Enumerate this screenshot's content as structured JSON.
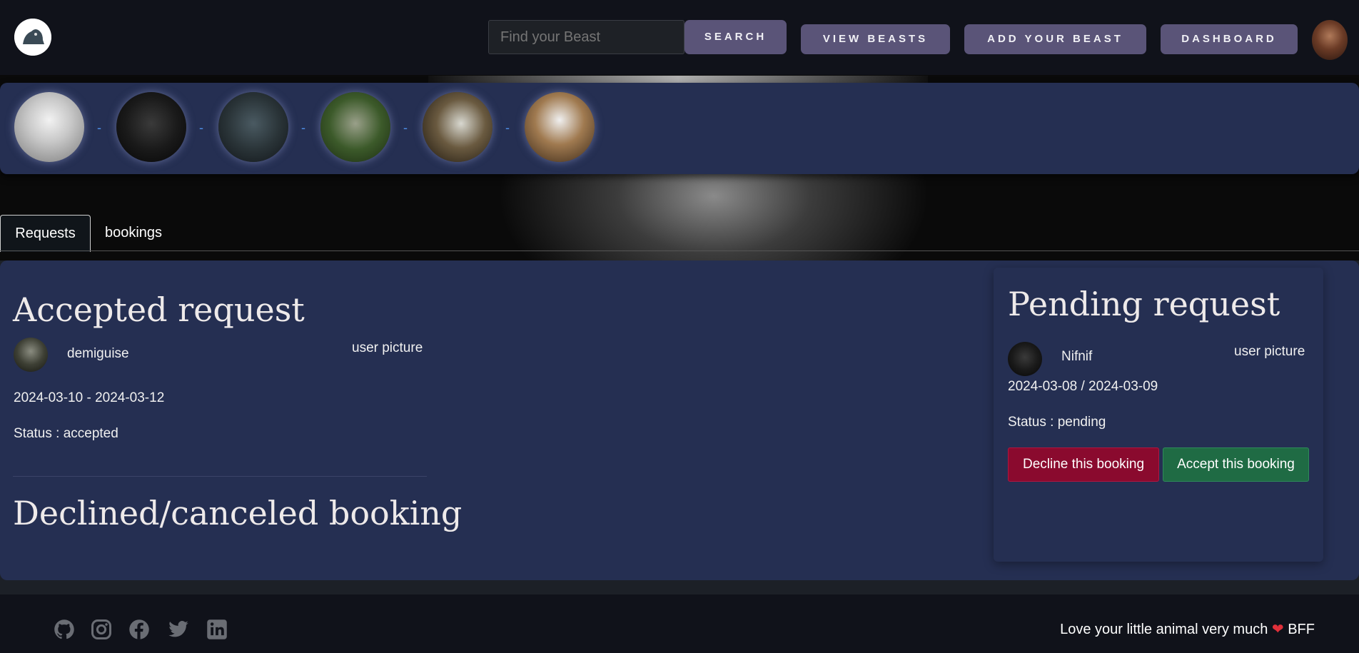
{
  "nav": {
    "search_placeholder": "Find your Beast",
    "search_label": "SEARCH",
    "view_beasts_label": "VIEW BEASTS",
    "add_beast_label": "ADD YOUR BEAST",
    "dashboard_label": "DASHBOARD"
  },
  "beasts": [
    {
      "icon": "snowy-owl-photo"
    },
    {
      "icon": "dark-creature-photo"
    },
    {
      "icon": "thestral-photo"
    },
    {
      "icon": "hippogriff-photo"
    },
    {
      "icon": "demiguise-photo"
    },
    {
      "icon": "bird-creature-photo"
    }
  ],
  "beast_separator": "-",
  "tabs": {
    "requests": "Requests",
    "bookings": "bookings"
  },
  "accepted": {
    "title": "Accepted request",
    "beast_name": "demiguise",
    "user_picture_label": "user picture",
    "dates": "2024-03-10 - 2024-03-12",
    "status": "Status : accepted"
  },
  "declined": {
    "title": "Declined/canceled booking"
  },
  "pending": {
    "title": "Pending request",
    "beast_name": "Nifnif",
    "user_picture_label": "user picture",
    "dates": "2024-03-08 / 2024-03-09",
    "status": "Status : pending",
    "decline_label": "Decline this booking",
    "accept_label": "Accept this booking"
  },
  "footer": {
    "icons": [
      "github-icon",
      "instagram-icon",
      "facebook-icon",
      "twitter-icon",
      "linkedin-icon"
    ],
    "tagline_before": "Love your little animal very much",
    "tagline_after": "BFF"
  },
  "colors": {
    "panel": "#252f52",
    "nav_button": "#5a5478",
    "decline": "#8a0a2e",
    "accept": "#1f6b44"
  }
}
